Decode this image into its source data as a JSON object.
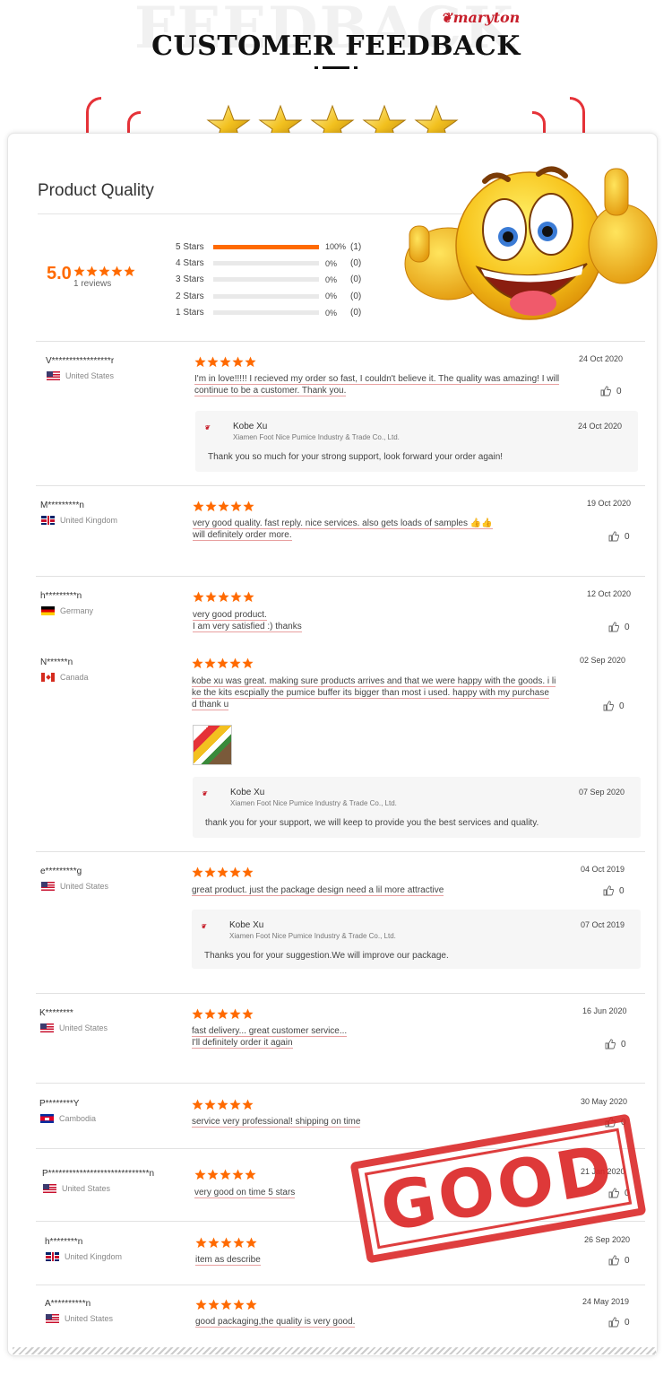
{
  "header": {
    "background_word": "FEEDBACK",
    "brand": "maryton",
    "title": "CUSTOMER FEEDBACK"
  },
  "summary": {
    "section_title": "Product Quality",
    "score": "5.0",
    "review_count": "1 reviews",
    "distribution": [
      {
        "label": "5 Stars",
        "fraction": 1.0,
        "pct": "100%",
        "count": "(1)"
      },
      {
        "label": "4 Stars",
        "fraction": 0.0,
        "pct": "0%",
        "count": "(0)"
      },
      {
        "label": "3 Stars",
        "fraction": 0.0,
        "pct": "0%",
        "count": "(0)"
      },
      {
        "label": "2 Stars",
        "fraction": 0.0,
        "pct": "0%",
        "count": "(0)"
      },
      {
        "label": "1 Stars",
        "fraction": 0.0,
        "pct": "0%",
        "count": "(0)"
      }
    ]
  },
  "reviews": [
    {
      "name": "V*****************r",
      "country": "United States",
      "flag": "us",
      "date": "24 Oct 2020",
      "text": [
        "I'm in love!!!!! I recieved my order so fast, I couldn't believe it.  The quality was amazing! I will",
        "continue to be a customer.  Thank you."
      ],
      "likes": "0",
      "reply": {
        "name": "Kobe Xu",
        "company": "Xiamen Foot Nice Pumice Industry & Trade Co., Ltd.",
        "date": "24 Oct 2020",
        "text": "Thank you so much for your strong support, look forward your order again!"
      }
    },
    {
      "name": "M*********n",
      "country": "United Kingdom",
      "flag": "uk",
      "date": "19 Oct 2020",
      "text": [
        "very good quality. fast reply. nice services. also gets loads of samples 👍👍",
        "will definitely order more."
      ],
      "likes": "0"
    },
    {
      "name": "h*********n",
      "country": "Germany",
      "flag": "de",
      "date": "12 Oct 2020",
      "text": [
        "very good product.",
        "I am very satisfied :) thanks"
      ],
      "likes": "0"
    },
    {
      "name": "N******n",
      "country": "Canada",
      "flag": "ca",
      "date": "02 Sep 2020",
      "text": [
        "kobe xu was great. making sure products arrives and that we were happy with the goods. i li",
        "ke the kits escpially the pumice buffer its bigger than  most i used. happy with my purchase",
        "d thank u"
      ],
      "likes": "0",
      "reply": {
        "name": "Kobe Xu",
        "company": "Xiamen Foot Nice Pumice Industry & Trade Co., Ltd.",
        "date": "07 Sep 2020",
        "text": "thank you for your support, we will keep to provide you the best services and quality."
      }
    },
    {
      "name": "e*********g",
      "country": "United States",
      "flag": "us",
      "date": "04 Oct 2019",
      "text": [
        "great product. just the package design need a lil more attractive"
      ],
      "likes": "0",
      "reply": {
        "name": "Kobe Xu",
        "company": "Xiamen Foot Nice Pumice Industry & Trade Co., Ltd.",
        "date": "07 Oct 2019",
        "text": "Thanks you for your suggestion.We will improve our package."
      }
    },
    {
      "name": "K********",
      "country": "United States",
      "flag": "us",
      "date": "16 Jun 2020",
      "text": [
        "fast delivery... great customer service...",
        "I'll definitely order it again"
      ],
      "likes": "0"
    },
    {
      "name": "P********Y",
      "country": "Cambodia",
      "flag": "kh",
      "date": "30 May 2020",
      "text": [
        "service very professional! shipping on time"
      ],
      "likes": "0"
    },
    {
      "name": "P*****************************n",
      "country": "United States",
      "flag": "us",
      "date": "21 Jan 2020",
      "text": [
        "very good on time 5 stars"
      ],
      "likes": "0"
    },
    {
      "name": "h********n",
      "country": "United Kingdom",
      "flag": "uk",
      "date": "26 Sep 2020",
      "text": [
        "item as describe"
      ],
      "likes": "0"
    },
    {
      "name": "A**********n",
      "country": "United States",
      "flag": "us",
      "date": "24 May 2019",
      "text": [
        "good packaging,the quality is very good."
      ],
      "likes": "0"
    }
  ],
  "stamp": {
    "text": "GOOD"
  },
  "colors": {
    "accent_orange": "#ff6a00",
    "stamp_red": "#da2323",
    "bracket_red": "#e53238",
    "gold": "#f2c01e"
  }
}
